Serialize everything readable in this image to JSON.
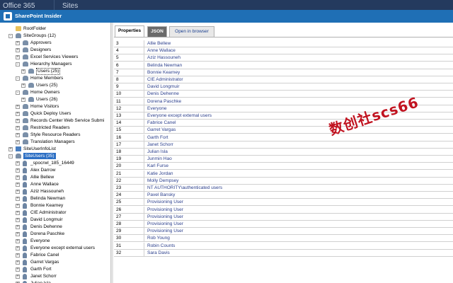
{
  "topbar": {
    "tabs": [
      "Office 365",
      "Sites"
    ]
  },
  "window": {
    "title": "SharePoint Insider"
  },
  "tree": {
    "items": [
      {
        "label": "RootFolder",
        "depth": 1,
        "expander": "",
        "icon": "folder"
      },
      {
        "label": "SiteGroups (12)",
        "depth": 1,
        "expander": "-",
        "icon": "group"
      },
      {
        "label": "Approvers",
        "depth": 2,
        "expander": "+",
        "icon": "group"
      },
      {
        "label": "Designers",
        "depth": 2,
        "expander": "+",
        "icon": "group"
      },
      {
        "label": "Excel Services Viewers",
        "depth": 2,
        "expander": "+",
        "icon": "group"
      },
      {
        "label": "Hierarchy Managers",
        "depth": 2,
        "expander": "-",
        "icon": "group"
      },
      {
        "label": "Users (25)",
        "depth": 3,
        "expander": "+",
        "icon": "group",
        "state": "focused"
      },
      {
        "label": "Home Members",
        "depth": 2,
        "expander": "-",
        "icon": "group"
      },
      {
        "label": "Users (25)",
        "depth": 3,
        "expander": "+",
        "icon": "group"
      },
      {
        "label": "Home Owners",
        "depth": 2,
        "expander": "-",
        "icon": "group"
      },
      {
        "label": "Users (26)",
        "depth": 3,
        "expander": "+",
        "icon": "group"
      },
      {
        "label": "Home Visitors",
        "depth": 2,
        "expander": "+",
        "icon": "group"
      },
      {
        "label": "Quick Deploy Users",
        "depth": 2,
        "expander": "+",
        "icon": "group"
      },
      {
        "label": "Records Center Web Service Submi",
        "depth": 2,
        "expander": "+",
        "icon": "group"
      },
      {
        "label": "Restricted Readers",
        "depth": 2,
        "expander": "+",
        "icon": "group"
      },
      {
        "label": "Style Resource Readers",
        "depth": 2,
        "expander": "+",
        "icon": "group"
      },
      {
        "label": "Translation Managers",
        "depth": 2,
        "expander": "+",
        "icon": "group"
      },
      {
        "label": "SiteUserInfoList",
        "depth": 1,
        "expander": "+",
        "icon": "list"
      },
      {
        "label": "SiteUsers (35)",
        "depth": 1,
        "expander": "-",
        "icon": "group",
        "state": "selected"
      },
      {
        "label": "_spocrwl_185_16449",
        "depth": 2,
        "expander": "+",
        "icon": "user"
      },
      {
        "label": "Alex Darrow",
        "depth": 2,
        "expander": "+",
        "icon": "user"
      },
      {
        "label": "Allie Bellew",
        "depth": 2,
        "expander": "+",
        "icon": "user"
      },
      {
        "label": "Anne Wallace",
        "depth": 2,
        "expander": "+",
        "icon": "user"
      },
      {
        "label": "Aziz Hassouneh",
        "depth": 2,
        "expander": "+",
        "icon": "user"
      },
      {
        "label": "Belinda Newman",
        "depth": 2,
        "expander": "+",
        "icon": "user"
      },
      {
        "label": "Bonnie Kearney",
        "depth": 2,
        "expander": "+",
        "icon": "user"
      },
      {
        "label": "CIE Administrator",
        "depth": 2,
        "expander": "+",
        "icon": "user"
      },
      {
        "label": "David Longmuir",
        "depth": 2,
        "expander": "+",
        "icon": "user"
      },
      {
        "label": "Denis Dehenne",
        "depth": 2,
        "expander": "+",
        "icon": "user"
      },
      {
        "label": "Dorena Paschke",
        "depth": 2,
        "expander": "+",
        "icon": "user"
      },
      {
        "label": "Everyone",
        "depth": 2,
        "expander": "+",
        "icon": "user"
      },
      {
        "label": "Everyone except external users",
        "depth": 2,
        "expander": "+",
        "icon": "user"
      },
      {
        "label": "Fabrice Canel",
        "depth": 2,
        "expander": "+",
        "icon": "user"
      },
      {
        "label": "Garret Vargas",
        "depth": 2,
        "expander": "+",
        "icon": "user"
      },
      {
        "label": "Garth Fort",
        "depth": 2,
        "expander": "+",
        "icon": "user"
      },
      {
        "label": "Janet Schorr",
        "depth": 2,
        "expander": "+",
        "icon": "user"
      },
      {
        "label": "Julian Isla",
        "depth": 2,
        "expander": "+",
        "icon": "user"
      }
    ]
  },
  "tabs": {
    "properties": "Properties",
    "json": "JSON",
    "open_in_browser": "Open in browser"
  },
  "grid": {
    "rows": [
      {
        "id": "3",
        "name": "Allie Bellew"
      },
      {
        "id": "4",
        "name": "Anne Wallace"
      },
      {
        "id": "5",
        "name": "Aziz Hassouneh"
      },
      {
        "id": "6",
        "name": "Belinda Newman"
      },
      {
        "id": "7",
        "name": "Bonnie Kearney"
      },
      {
        "id": "8",
        "name": "CIE Administrator"
      },
      {
        "id": "9",
        "name": "David Longmuir"
      },
      {
        "id": "10",
        "name": "Denis Dehenne"
      },
      {
        "id": "11",
        "name": "Dorena Paschke"
      },
      {
        "id": "12",
        "name": "Everyone"
      },
      {
        "id": "13",
        "name": "Everyone except external users"
      },
      {
        "id": "14",
        "name": "Fabrice Canel"
      },
      {
        "id": "15",
        "name": "Garret Vargas"
      },
      {
        "id": "16",
        "name": "Garth Fort"
      },
      {
        "id": "17",
        "name": "Janet Schorr"
      },
      {
        "id": "18",
        "name": "Julian Isla"
      },
      {
        "id": "19",
        "name": "Junmin Hao"
      },
      {
        "id": "20",
        "name": "Karl Furse"
      },
      {
        "id": "21",
        "name": "Katie Jordan"
      },
      {
        "id": "22",
        "name": "Molly Dempsey"
      },
      {
        "id": "23",
        "name": "NT AUTHORITY\\authenticated users"
      },
      {
        "id": "24",
        "name": "Pavel Bansky"
      },
      {
        "id": "25",
        "name": "Provisioning User"
      },
      {
        "id": "26",
        "name": "Provisioning User"
      },
      {
        "id": "27",
        "name": "Provisioning User"
      },
      {
        "id": "28",
        "name": "Provisioning User"
      },
      {
        "id": "29",
        "name": "Provisioning User"
      },
      {
        "id": "30",
        "name": "Rob Young"
      },
      {
        "id": "31",
        "name": "Robin Counts"
      },
      {
        "id": "32",
        "name": "Sara Davis"
      }
    ]
  },
  "watermark": "数创社scs66",
  "colors": {
    "titlebar": "#1f6fb5",
    "topbar": "#243a5e",
    "link": "#2b3f8c",
    "selection": "#2c6fc4",
    "watermark": "#c1121f"
  }
}
